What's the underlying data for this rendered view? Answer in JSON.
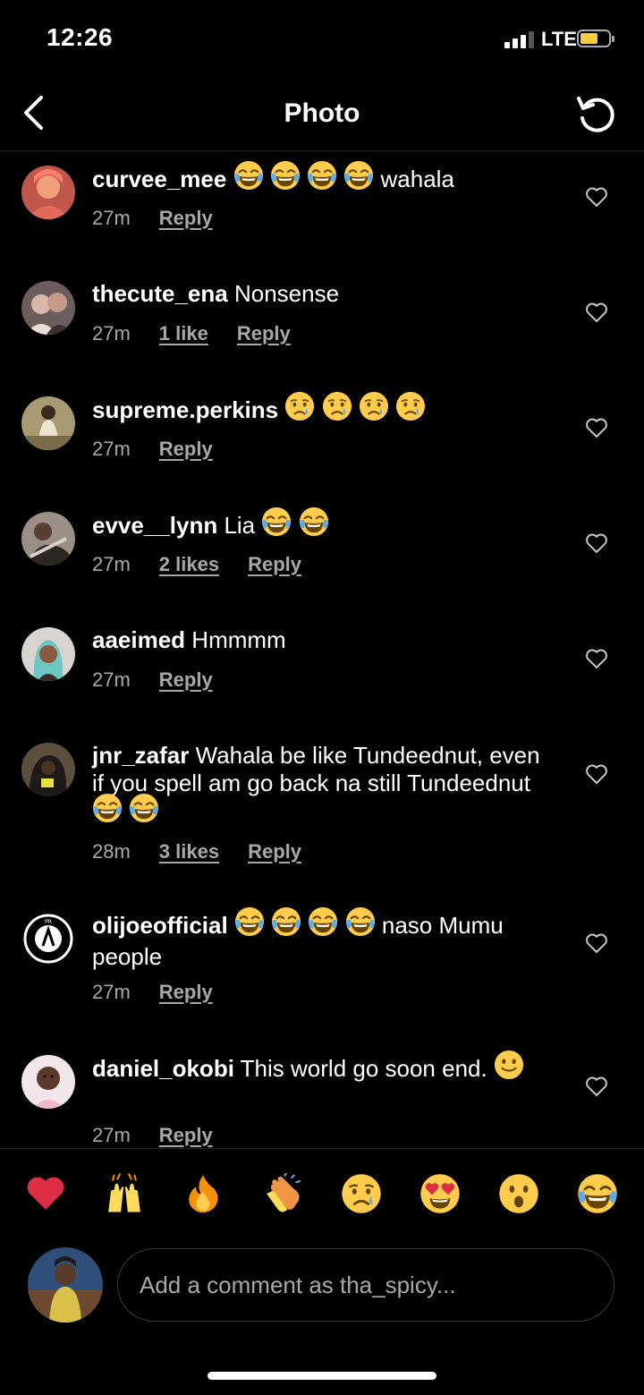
{
  "status": {
    "time": "12:26",
    "network": "LTE"
  },
  "nav": {
    "title": "Photo"
  },
  "comments": [
    {
      "username": "curvee_mee",
      "text": " wahala",
      "emoji_before_text": [
        "joy",
        "joy",
        "joy",
        "joy"
      ],
      "time": "27m",
      "likes": "",
      "reply": "Reply"
    },
    {
      "username": "thecute_ena",
      "text": " Nonsense",
      "time": "27m",
      "likes": "1 like",
      "reply": "Reply"
    },
    {
      "username": "supreme.perkins",
      "text": "",
      "emoji_after": [
        "cry",
        "cry",
        "cry",
        "cry"
      ],
      "time": "27m",
      "likes": "",
      "reply": "Reply"
    },
    {
      "username": "evve__lynn",
      "text": " Lia",
      "emoji_after": [
        "joy",
        "joy"
      ],
      "time": "27m",
      "likes": "2 likes",
      "reply": "Reply"
    },
    {
      "username": "aaeimed",
      "text": " Hmmmm",
      "time": "27m",
      "likes": "",
      "reply": "Reply"
    },
    {
      "username": "jnr_zafar",
      "text": " Wahala be like Tundeednut, even if you spell am go back na still Tundeednut",
      "emoji_after": [
        "joy",
        "joy"
      ],
      "time": "28m",
      "likes": "3 likes",
      "reply": "Reply"
    },
    {
      "username": "olijoeofficial",
      "text": " naso Mumu people",
      "emoji_before_text": [
        "joy",
        "joy",
        "joy",
        "joy"
      ],
      "time": "27m",
      "likes": "",
      "reply": "Reply"
    },
    {
      "username": "daniel_okobi",
      "text": " This world go soon end.",
      "emoji_after": [
        "smile"
      ],
      "time": "27m",
      "likes": "",
      "reply": "Reply"
    }
  ],
  "quick_reactions": [
    "heart",
    "raised-hands",
    "fire",
    "clap",
    "cry",
    "heart-eyes",
    "wow",
    "joy"
  ],
  "composer": {
    "placeholder": "Add a comment as tha_spicy..."
  },
  "colors": {
    "background": "#000000",
    "secondary_text": "#a8a8a8",
    "heart_red": "#ed4956",
    "battery": "#f5cc42"
  }
}
